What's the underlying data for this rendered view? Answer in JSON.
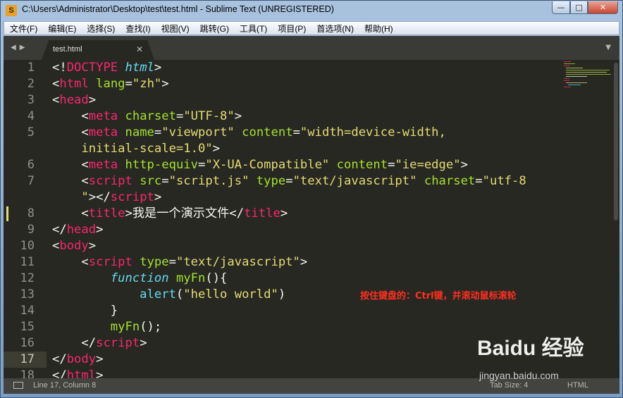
{
  "window": {
    "title": "C:\\Users\\Administrator\\Desktop\\test\\test.html - Sublime Text (UNREGISTERED)",
    "app_icon_letter": "S",
    "minimize": "—",
    "maximize": "□",
    "close": "✕"
  },
  "menu": [
    "文件(F)",
    "编辑(E)",
    "选择(S)",
    "查找(I)",
    "视图(V)",
    "跳转(G)",
    "工具(T)",
    "项目(P)",
    "首选项(N)",
    "帮助(H)"
  ],
  "tabs": {
    "nav_arrows": "◀▶",
    "active": {
      "label": "test.html",
      "close": "✕"
    },
    "dropdown": "▼"
  },
  "editor": {
    "line_numbers": [
      "1",
      "2",
      "3",
      "4",
      "5",
      "",
      "6",
      "7",
      "",
      "8",
      "9",
      "10",
      "11",
      "12",
      "13",
      "14",
      "15",
      "16",
      "17",
      "18"
    ],
    "active_line": "17",
    "modified_line": "8",
    "lines": [
      [
        [
          "pl",
          "<!"
        ],
        [
          "tg",
          "DOCTYPE"
        ],
        [
          "pl",
          " "
        ],
        [
          "kw",
          "html"
        ],
        [
          "pl",
          ">"
        ]
      ],
      [
        [
          "pl",
          "<"
        ],
        [
          "tg",
          "html"
        ],
        [
          "pl",
          " "
        ],
        [
          "at",
          "lang"
        ],
        [
          "pl",
          "="
        ],
        [
          "st",
          "\"zh\""
        ],
        [
          "pl",
          ">"
        ]
      ],
      [
        [
          "pl",
          "<"
        ],
        [
          "tg",
          "head"
        ],
        [
          "pl",
          ">"
        ]
      ],
      [
        [
          "pl",
          "    <"
        ],
        [
          "tg",
          "meta"
        ],
        [
          "pl",
          " "
        ],
        [
          "at",
          "charset"
        ],
        [
          "pl",
          "="
        ],
        [
          "st",
          "\"UTF-8\""
        ],
        [
          "pl",
          ">"
        ]
      ],
      [
        [
          "pl",
          "    <"
        ],
        [
          "tg",
          "meta"
        ],
        [
          "pl",
          " "
        ],
        [
          "at",
          "name"
        ],
        [
          "pl",
          "="
        ],
        [
          "st",
          "\"viewport\""
        ],
        [
          "pl",
          " "
        ],
        [
          "at",
          "content"
        ],
        [
          "pl",
          "="
        ],
        [
          "st",
          "\"width=device-width,"
        ]
      ],
      [
        [
          "st",
          "    initial-scale=1.0\""
        ],
        [
          "pl",
          ">"
        ]
      ],
      [
        [
          "pl",
          "    <"
        ],
        [
          "tg",
          "meta"
        ],
        [
          "pl",
          " "
        ],
        [
          "at",
          "http-equiv"
        ],
        [
          "pl",
          "="
        ],
        [
          "st",
          "\"X-UA-Compatible\""
        ],
        [
          "pl",
          " "
        ],
        [
          "at",
          "content"
        ],
        [
          "pl",
          "="
        ],
        [
          "st",
          "\"ie=edge\""
        ],
        [
          "pl",
          ">"
        ]
      ],
      [
        [
          "pl",
          "    <"
        ],
        [
          "tg",
          "script"
        ],
        [
          "pl",
          " "
        ],
        [
          "at",
          "src"
        ],
        [
          "pl",
          "="
        ],
        [
          "st",
          "\"script.js\""
        ],
        [
          "pl",
          " "
        ],
        [
          "at",
          "type"
        ],
        [
          "pl",
          "="
        ],
        [
          "st",
          "\"text/javascript\""
        ],
        [
          "pl",
          " "
        ],
        [
          "at",
          "charset"
        ],
        [
          "pl",
          "="
        ],
        [
          "st",
          "\"utf-8"
        ]
      ],
      [
        [
          "st",
          "    \""
        ],
        [
          "pl",
          "></"
        ],
        [
          "tg",
          "script"
        ],
        [
          "pl",
          ">"
        ]
      ],
      [
        [
          "pl",
          "    <"
        ],
        [
          "tg",
          "title"
        ],
        [
          "pl",
          ">"
        ],
        [
          "cjk",
          "我是一个演示文件"
        ],
        [
          "pl",
          "</"
        ],
        [
          "tg",
          "title"
        ],
        [
          "pl",
          ">"
        ]
      ],
      [
        [
          "pl",
          "</"
        ],
        [
          "tg",
          "head"
        ],
        [
          "pl",
          ">"
        ]
      ],
      [
        [
          "pl",
          "<"
        ],
        [
          "tg",
          "body"
        ],
        [
          "pl",
          ">"
        ]
      ],
      [
        [
          "pl",
          "    <"
        ],
        [
          "tg",
          "script"
        ],
        [
          "pl",
          " "
        ],
        [
          "at",
          "type"
        ],
        [
          "pl",
          "="
        ],
        [
          "st",
          "\"text/javascript\""
        ],
        [
          "pl",
          ">"
        ]
      ],
      [
        [
          "kw",
          "        function"
        ],
        [
          "pl",
          " "
        ],
        [
          "fn",
          "myFn"
        ],
        [
          "pl",
          "(){"
        ]
      ],
      [
        [
          "bi",
          "            alert"
        ],
        [
          "pl",
          "("
        ],
        [
          "st",
          "\"hello world\""
        ],
        [
          "pl",
          ")"
        ]
      ],
      [
        [
          "pl",
          "        }"
        ]
      ],
      [
        [
          "fn",
          "        myFn"
        ],
        [
          "pl",
          "();"
        ]
      ],
      [
        [
          "pl",
          "    </"
        ],
        [
          "tg",
          "script"
        ],
        [
          "pl",
          ">"
        ]
      ],
      [
        [
          "pl",
          "</"
        ],
        [
          "tg",
          "body"
        ],
        [
          "pl",
          ">"
        ]
      ],
      [
        [
          "pl",
          "</"
        ],
        [
          "tg",
          "html"
        ],
        [
          "pl",
          ">"
        ]
      ]
    ]
  },
  "annotation": "按住键盘的：Ctrl键，并滚动鼠标滚轮",
  "status": {
    "position": "Line 17, Column 8",
    "tab_size": "Tab Size: 4",
    "syntax": "HTML"
  },
  "watermark": {
    "brand": "Baidu 经验",
    "url": "jingyan.baidu.com"
  },
  "colors": {
    "tag": "#f92672",
    "attr": "#a6e22e",
    "string": "#e6db74",
    "keyword": "#66d9ef",
    "annotation": "#ff2f1f",
    "editor_bg": "#272822"
  }
}
